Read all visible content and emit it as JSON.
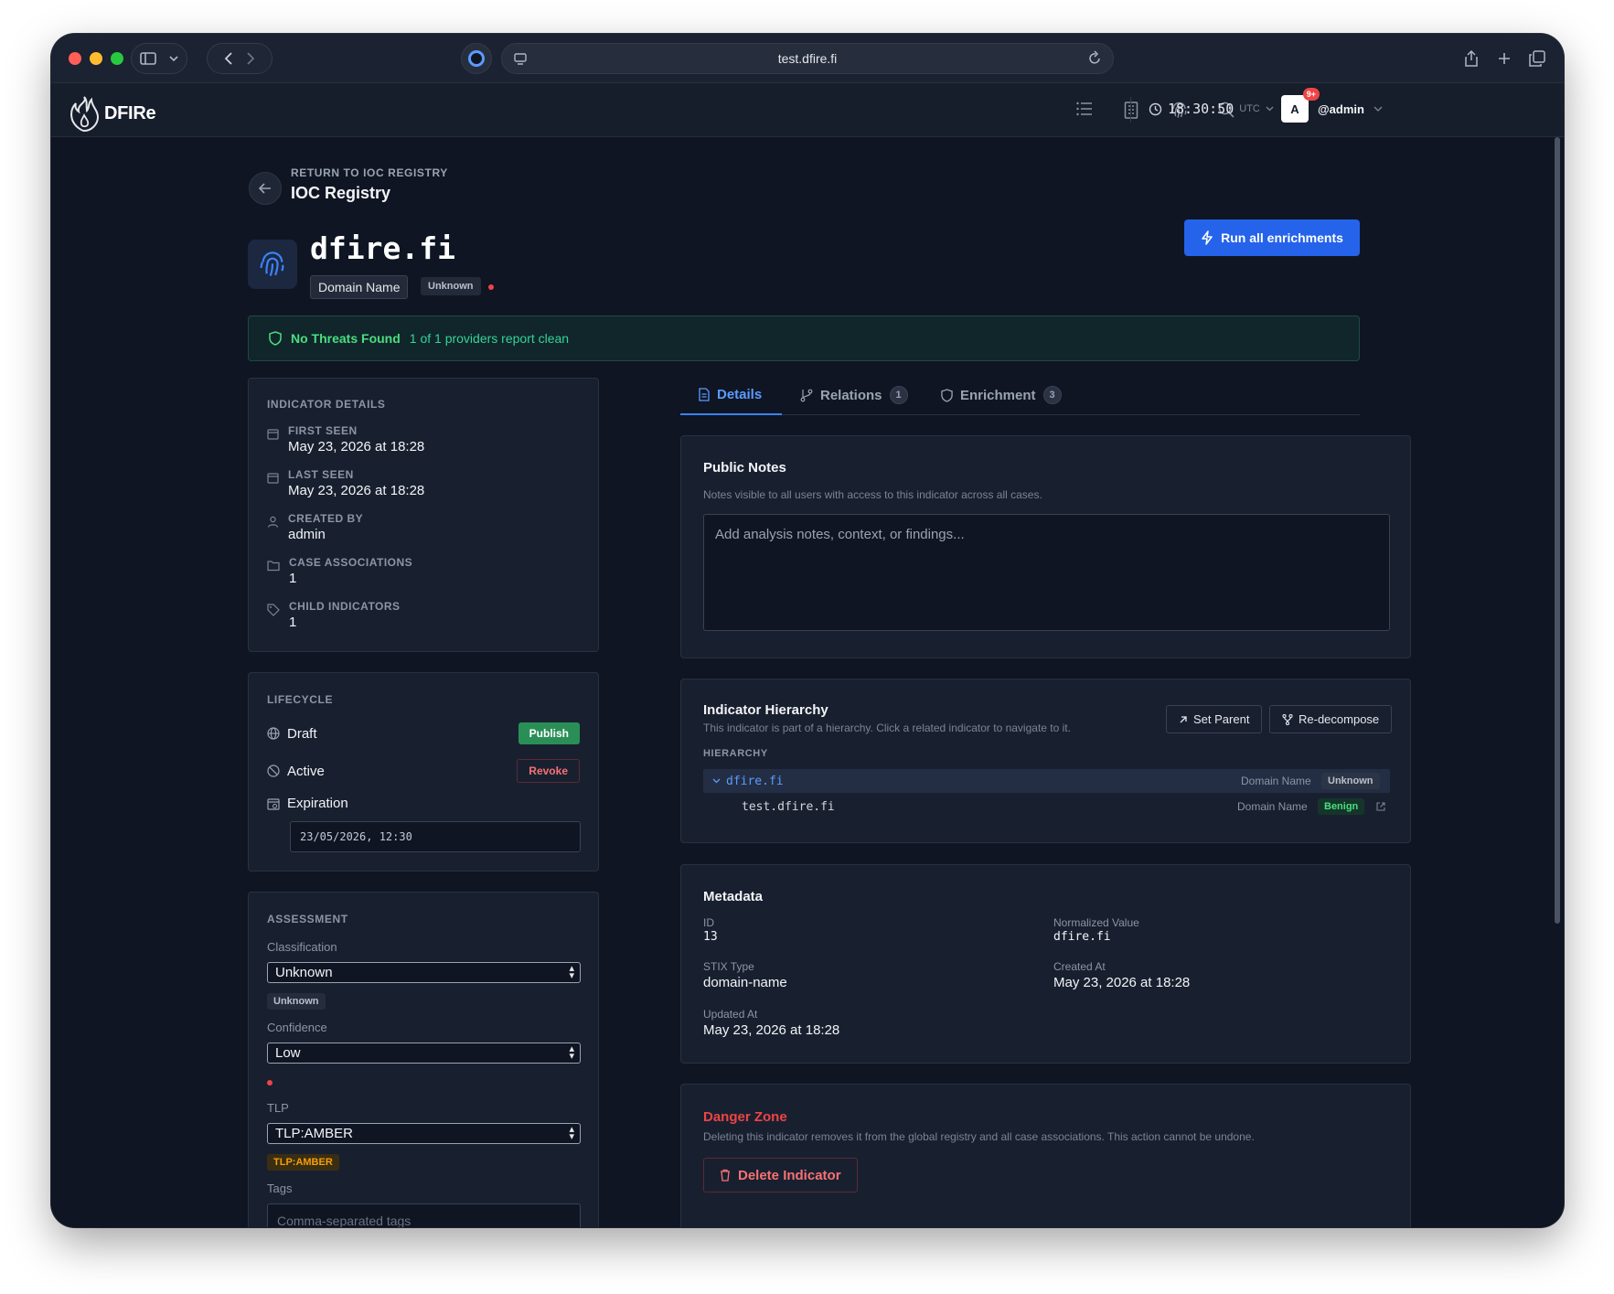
{
  "browser": {
    "url": "test.dfire.fi"
  },
  "app": {
    "brand": "DFIRe",
    "clock_time": "18:30:50",
    "clock_tz": "UTC",
    "avatar_letter": "A",
    "notification_count": "9+",
    "username": "@admin"
  },
  "breadcrumb": {
    "return_label": "RETURN TO IOC REGISTRY",
    "title": "IOC Registry"
  },
  "indicator": {
    "value": "dfire.fi",
    "type": "Domain Name",
    "classification": "Unknown",
    "run_enrichments_label": "Run all enrichments"
  },
  "threat_banner": {
    "title": "No Threats Found",
    "subtitle": "1 of 1 providers report clean"
  },
  "details_card": {
    "heading": "INDICATOR DETAILS",
    "first_seen_label": "FIRST SEEN",
    "first_seen": "May 23, 2026 at 18:28",
    "last_seen_label": "LAST SEEN",
    "last_seen": "May 23, 2026 at 18:28",
    "created_by_label": "CREATED BY",
    "created_by": "admin",
    "case_assoc_label": "CASE ASSOCIATIONS",
    "case_assoc": "1",
    "child_label": "CHILD INDICATORS",
    "child": "1"
  },
  "lifecycle": {
    "heading": "LIFECYCLE",
    "draft_label": "Draft",
    "publish_label": "Publish",
    "active_label": "Active",
    "revoke_label": "Revoke",
    "expiration_label": "Expiration",
    "expiration_value": "23/05/2026, 12:30"
  },
  "assessment": {
    "heading": "ASSESSMENT",
    "classification_label": "Classification",
    "classification_value": "Unknown",
    "classification_badge": "Unknown",
    "confidence_label": "Confidence",
    "confidence_value": "Low",
    "tlp_label": "TLP",
    "tlp_value": "TLP:AMBER",
    "tlp_badge": "TLP:AMBER",
    "tags_label": "Tags",
    "tags_placeholder": "Comma-separated tags"
  },
  "tabs": [
    {
      "label": "Details"
    },
    {
      "label": "Relations",
      "count": "1"
    },
    {
      "label": "Enrichment",
      "count": "3"
    }
  ],
  "public_notes": {
    "title": "Public Notes",
    "description": "Notes visible to all users with access to this indicator across all cases.",
    "placeholder": "Add analysis notes, context, or findings..."
  },
  "hierarchy": {
    "title": "Indicator Hierarchy",
    "description": "This indicator is part of a hierarchy. Click a related indicator to navigate to it.",
    "set_parent_label": "Set Parent",
    "redecompose_label": "Re-decompose",
    "section_label": "HIERARCHY",
    "rows": [
      {
        "value": "dfire.fi",
        "type": "Domain Name",
        "classification": "Unknown"
      },
      {
        "value": "test.dfire.fi",
        "type": "Domain Name",
        "classification": "Benign"
      }
    ]
  },
  "metadata": {
    "title": "Metadata",
    "id_label": "ID",
    "id": "13",
    "normalized_label": "Normalized Value",
    "normalized": "dfire.fi",
    "stix_label": "STIX Type",
    "stix": "domain-name",
    "created_label": "Created At",
    "created": "May 23, 2026 at 18:28",
    "updated_label": "Updated At",
    "updated": "May 23, 2026 at 18:28"
  },
  "danger_zone": {
    "title": "Danger Zone",
    "description": "Deleting this indicator removes it from the global registry and all case associations. This action cannot be undone.",
    "delete_label": "Delete Indicator"
  },
  "colors": {
    "accent": "#2563eb",
    "success": "#2a8f57",
    "danger": "#ef4444",
    "amber": "#f59e0b"
  }
}
